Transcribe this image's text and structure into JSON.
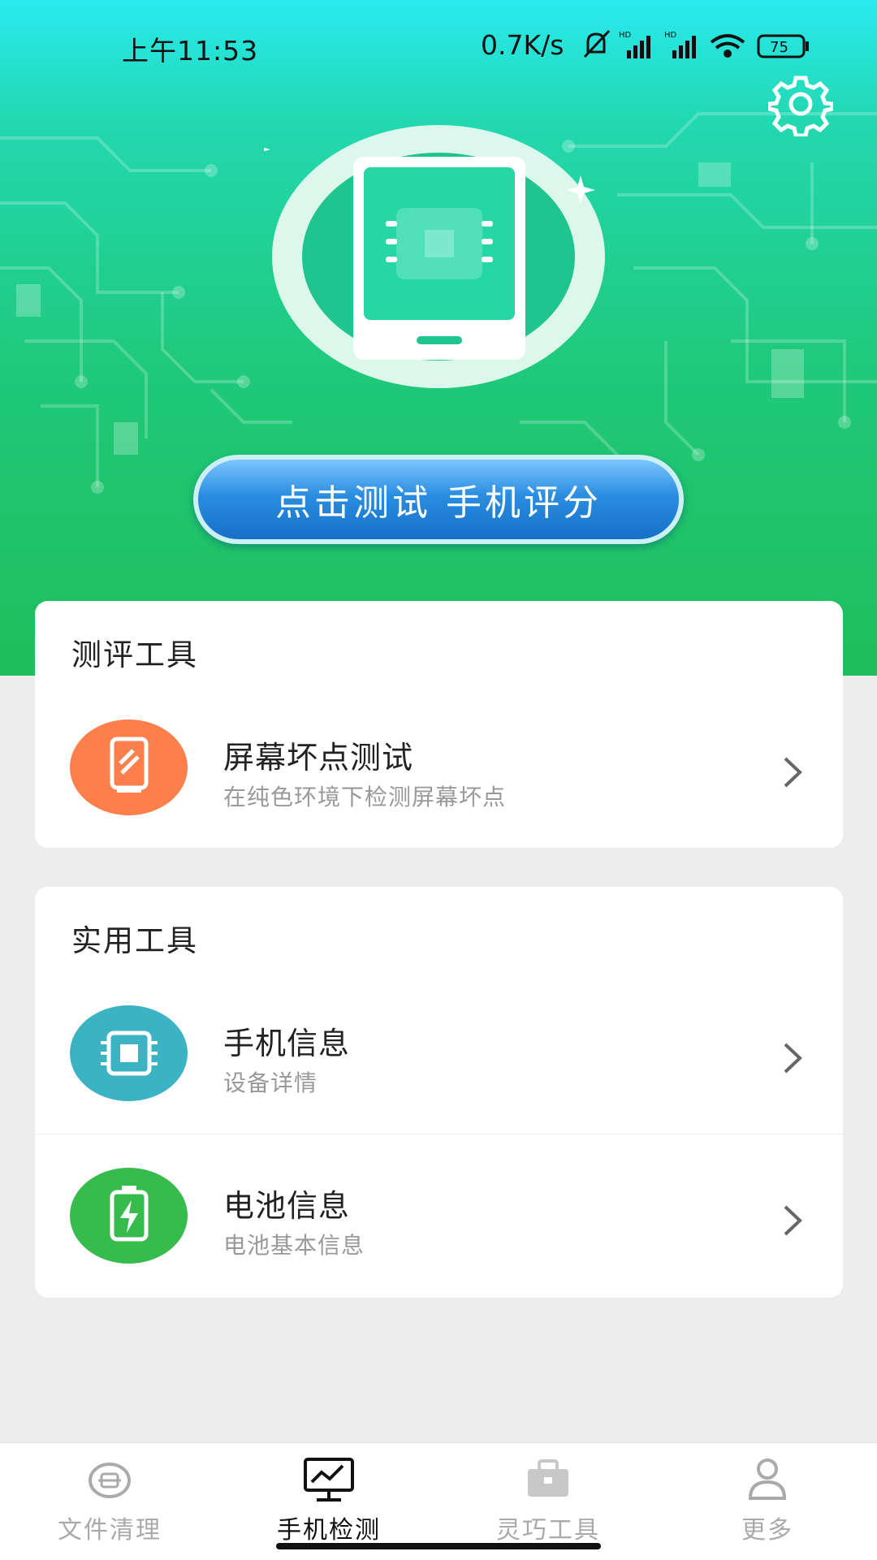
{
  "status_bar": {
    "time": "上午11:53",
    "network_speed": "0.7K/s",
    "battery_level": "75",
    "icons": [
      "mute-icon",
      "hd-signal-icon",
      "hd-signal-icon",
      "wifi-icon",
      "battery-icon"
    ]
  },
  "hero": {
    "settings_icon": "gear-icon",
    "test_button_label": "点击测试 手机评分"
  },
  "sections": [
    {
      "title": "测评工具",
      "items": [
        {
          "name": "屏幕坏点测试",
          "desc": "在纯色环境下检测屏幕坏点",
          "icon": "screen-test-icon",
          "color": "#fd7f4c"
        }
      ]
    },
    {
      "title": "实用工具",
      "items": [
        {
          "name": "手机信息",
          "desc": "设备详情",
          "icon": "chip-icon",
          "color": "#3bb3c3"
        },
        {
          "name": "电池信息",
          "desc": "电池基本信息",
          "icon": "battery-charge-icon",
          "color": "#36bb4c"
        }
      ]
    }
  ],
  "tab_bar": {
    "active_index": 1,
    "tabs": [
      {
        "label": "文件清理",
        "icon": "clean-icon"
      },
      {
        "label": "手机检测",
        "icon": "monitor-icon"
      },
      {
        "label": "灵巧工具",
        "icon": "toolbox-icon"
      },
      {
        "label": "更多",
        "icon": "profile-icon"
      }
    ]
  },
  "colors": {
    "hero_green": "#1fc97a",
    "hero_cyan": "#29eaf0",
    "button_blue": "#2a8ddf",
    "background": "#ededed"
  }
}
